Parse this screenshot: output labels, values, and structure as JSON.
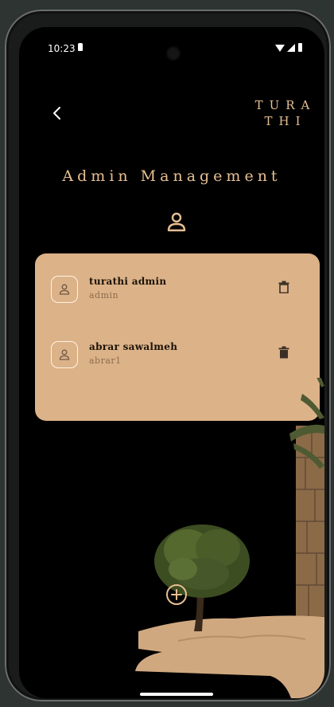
{
  "status_bar": {
    "time": "10:23"
  },
  "header": {
    "brand": "TURA THI",
    "brand_line1": "TURA",
    "brand_line2": "THI"
  },
  "page": {
    "title": "Admin Management"
  },
  "admins": [
    {
      "name": "turathi admin",
      "username": "admin"
    },
    {
      "name": "abrar sawalmeh",
      "username": "abrar1"
    }
  ],
  "colors": {
    "accent": "#e7bf92",
    "card": "#dcb288",
    "background": "#000000"
  },
  "icons": {
    "back": "chevron-left-icon",
    "header_user": "user-icon",
    "avatar": "user-icon",
    "delete": "trash-icon",
    "add": "plus-circle-icon"
  }
}
